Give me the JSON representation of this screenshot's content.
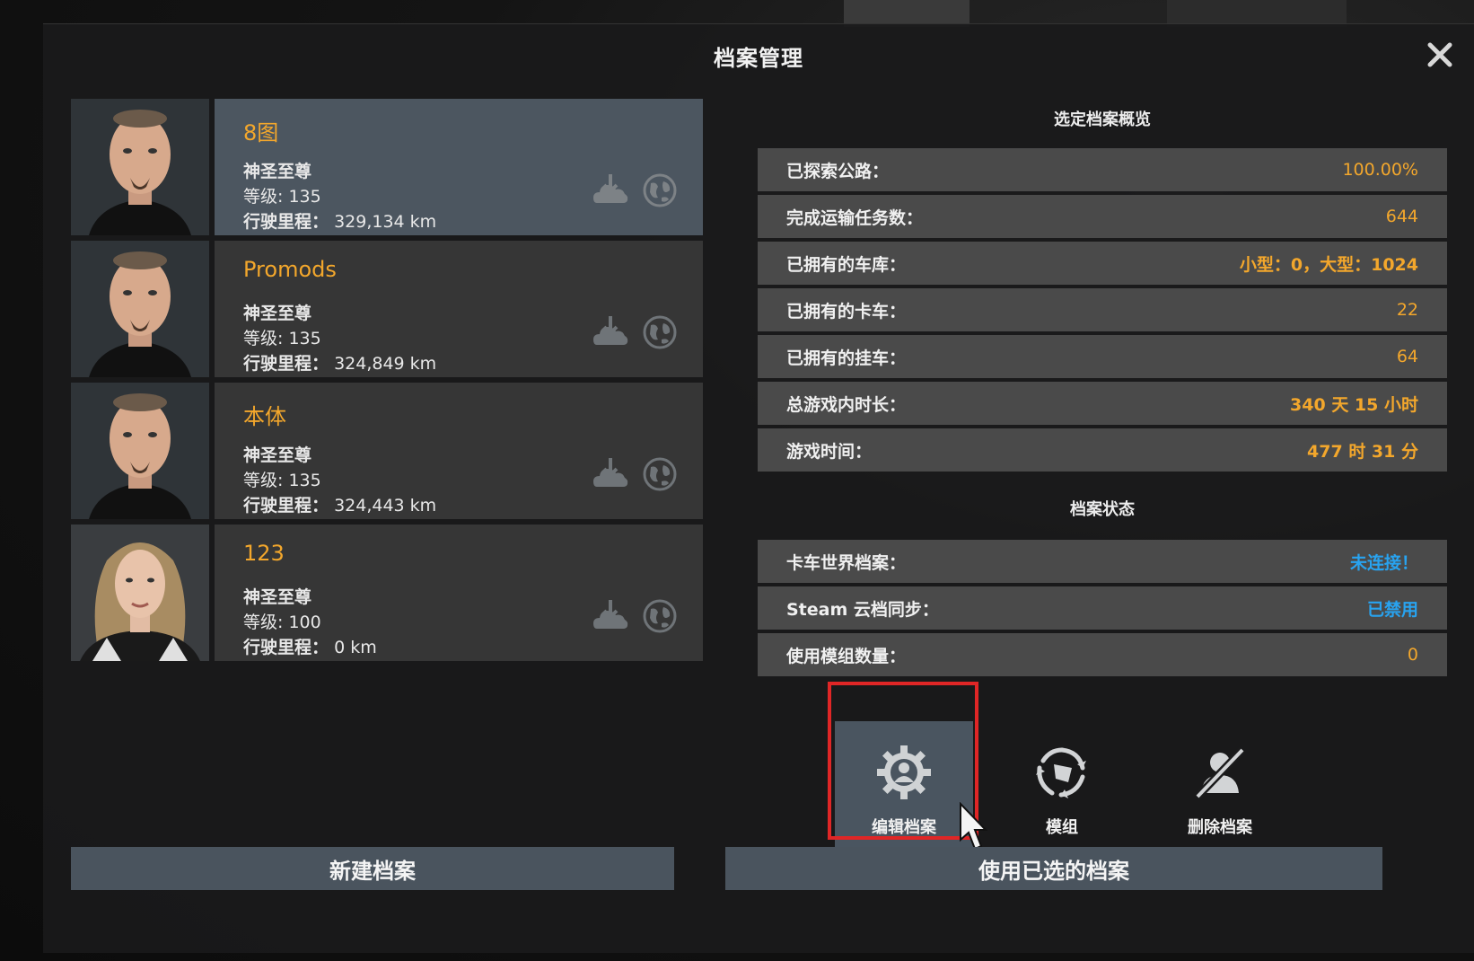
{
  "dialog": {
    "title": "档案管理"
  },
  "profiles": [
    {
      "name": "8图",
      "rank": "神圣至尊",
      "level": "等级: 135",
      "distance_label": "行驶里程：",
      "distance": "329,134 km",
      "avatar": "male-driver"
    },
    {
      "name": "Promods",
      "rank": "神圣至尊",
      "level": "等级: 135",
      "distance_label": "行驶里程：",
      "distance": "324,849 km",
      "avatar": "male-driver"
    },
    {
      "name": "本体",
      "rank": "神圣至尊",
      "level": "等级: 135",
      "distance_label": "行驶里程：",
      "distance": "324,443 km",
      "avatar": "male-driver"
    },
    {
      "name": "123",
      "rank": "神圣至尊",
      "level": "等级: 100",
      "distance_label": "行驶里程：",
      "distance": "0 km",
      "avatar": "female-driver"
    }
  ],
  "overview": {
    "title": "选定档案概览",
    "stats": [
      {
        "label": "已探索公路：",
        "value": "100.00%"
      },
      {
        "label": "完成运输任务数：",
        "value": "644"
      },
      {
        "label": "已拥有的车库：",
        "value": "小型：0，大型：1024"
      },
      {
        "label": "已拥有的卡车：",
        "value": "22"
      },
      {
        "label": "已拥有的挂车：",
        "value": "64"
      },
      {
        "label": "总游戏内时长：",
        "value": "340 天 15 小时"
      },
      {
        "label": "游戏时间：",
        "value": "477 时 31 分"
      }
    ]
  },
  "status": {
    "title": "档案状态",
    "items": [
      {
        "label": "卡车世界档案：",
        "value": "未连接！"
      },
      {
        "label": "Steam 云档同步：",
        "value": "已禁用"
      },
      {
        "label": "使用模组数量：",
        "value": "0"
      }
    ]
  },
  "actions": {
    "edit": "编辑档案",
    "mods": "模组",
    "delete": "删除档案"
  },
  "buttons": {
    "new_profile": "新建档案",
    "use_selected": "使用已选的档案"
  },
  "colors": {
    "accent_orange": "#f3a72c",
    "status_blue": "#28a3f0",
    "selected_row": "#4c5660",
    "highlight_red": "#e02626"
  },
  "icons": {
    "close": "close-icon",
    "cloud": "cloud-download-icon",
    "world": "globe-icon",
    "edit": "gear-person-icon",
    "mods": "mods-icon",
    "delete": "delete-profile-icon"
  }
}
